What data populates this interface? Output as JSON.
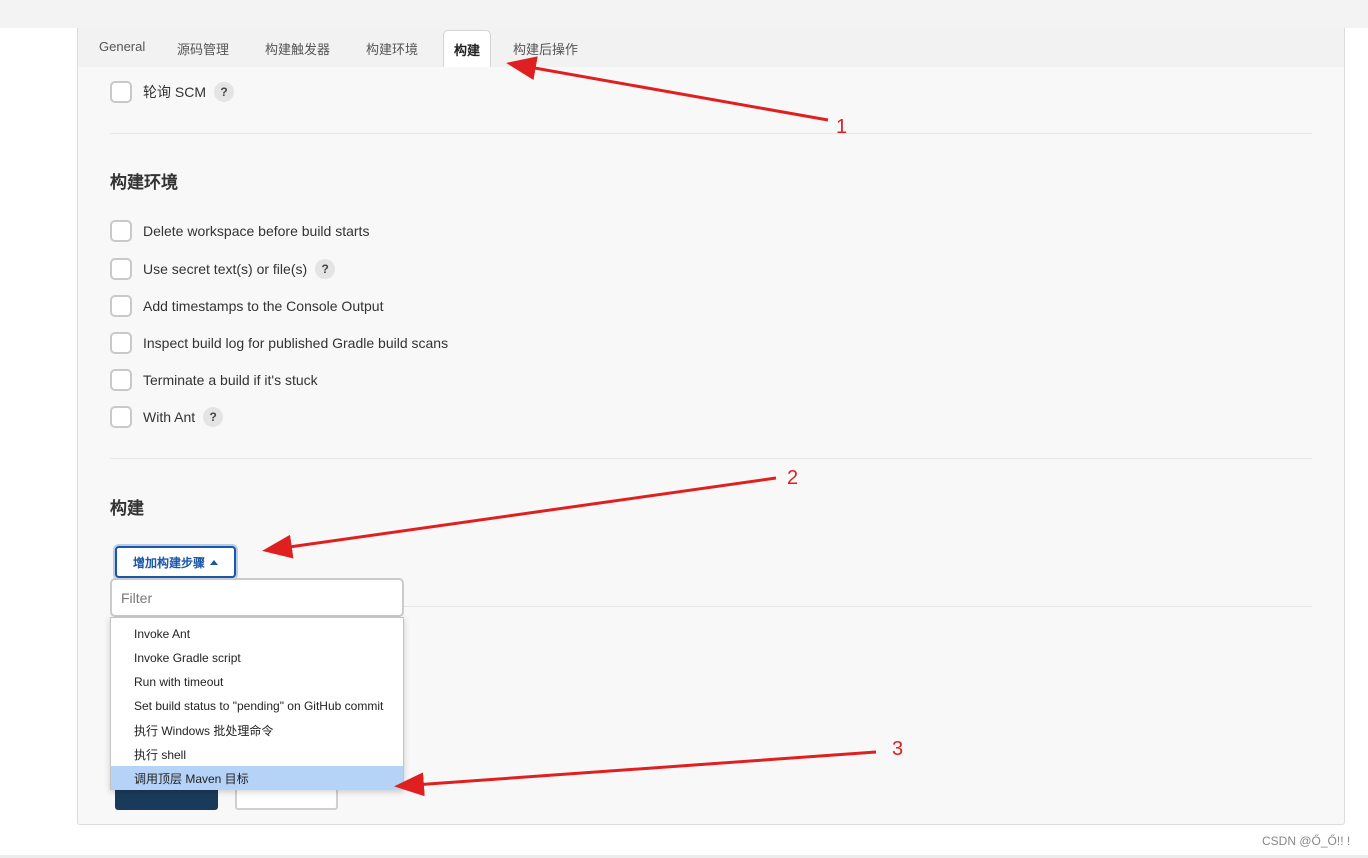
{
  "tabs": [
    {
      "label": "General",
      "active": false
    },
    {
      "label": "源码管理",
      "active": false
    },
    {
      "label": "构建触发器",
      "active": false
    },
    {
      "label": "构建环境",
      "active": false
    },
    {
      "label": "构建",
      "active": true
    },
    {
      "label": "构建后操作",
      "active": false
    }
  ],
  "triggers": {
    "poll_scm": {
      "label": "轮询 SCM",
      "checked": false
    }
  },
  "build_env": {
    "title": "构建环境",
    "options": [
      {
        "label": "Delete workspace before build starts",
        "checked": false
      },
      {
        "label": "Use secret text(s) or file(s)",
        "checked": false
      },
      {
        "label": "Add timestamps to the Console Output",
        "checked": false
      },
      {
        "label": "Inspect build log for published Gradle build scans",
        "checked": false
      },
      {
        "label": "Terminate a build if it's stuck",
        "checked": false
      },
      {
        "label": "With Ant",
        "checked": false
      }
    ]
  },
  "help_glyph": "?",
  "build": {
    "title": "构建",
    "add_step_label": "增加构建步骤",
    "filter_placeholder": "Filter",
    "menu_items": [
      "Invoke Ant",
      "Invoke Gradle script",
      "Run with timeout",
      "Set build status to \"pending\" on GitHub commit",
      "执行 Windows 批处理命令",
      "执行 shell",
      "调用顶层 Maven 目标"
    ],
    "highlighted_item": "调用顶层 Maven 目标"
  },
  "annotations": [
    "1",
    "2",
    "3"
  ],
  "annotation_color": "#e02020",
  "watermark": "CSDN @Ő_Ő!! !",
  "colors": {
    "accent": "#1b56a7",
    "highlight": "#b4d3f6",
    "save_button": "#1a3a5c"
  }
}
